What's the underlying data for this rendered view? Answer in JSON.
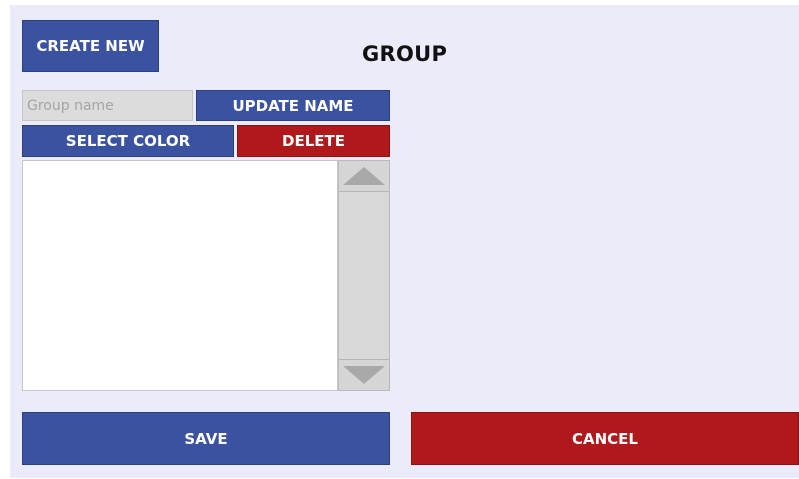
{
  "header": {
    "create_new_label": "CREATE NEW",
    "title": "GROUP"
  },
  "name_row": {
    "group_name_placeholder": "Group name",
    "group_name_value": "",
    "update_name_label": "UPDATE NAME"
  },
  "action_row": {
    "select_color_label": "SELECT COLOR",
    "delete_label": "DELETE"
  },
  "group_list": {
    "items": [],
    "scroll_up_icon": "triangle-up-icon",
    "scroll_down_icon": "triangle-down-icon"
  },
  "footer": {
    "save_label": "SAVE",
    "cancel_label": "CANCEL"
  },
  "colors": {
    "background": "#ecebfa",
    "primary_blue": "#3a52a0",
    "danger_red": "#b0191c",
    "input_bg": "#dcdcdc",
    "scrollbar_bg": "#d9d9d9",
    "arrow": "#a9a9a9"
  }
}
